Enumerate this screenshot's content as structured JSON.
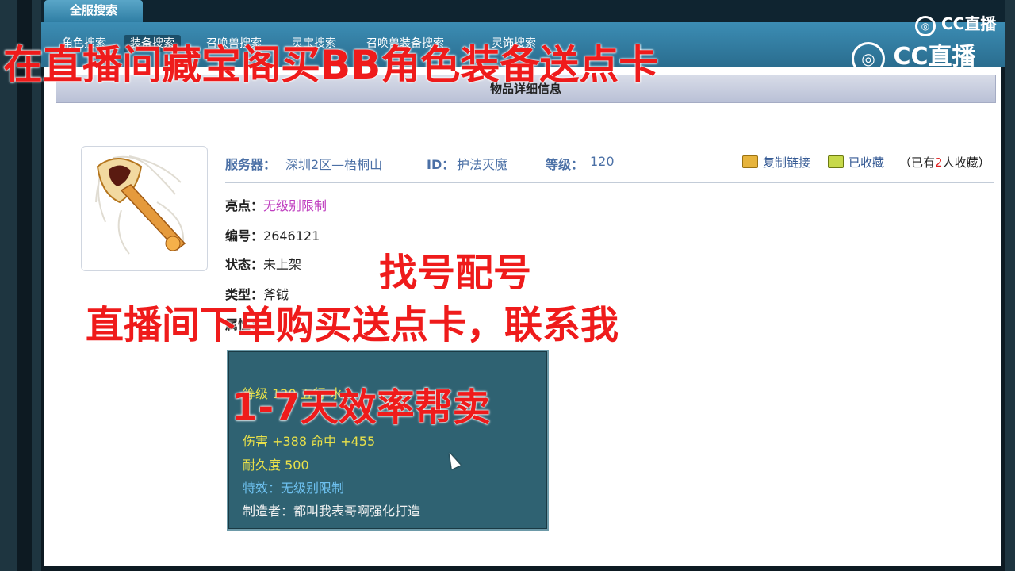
{
  "header": {
    "main_tab": "全服搜索",
    "sub_tabs": [
      "角色搜索",
      "装备搜索",
      "召唤兽搜索",
      "灵宝搜索",
      "召唤兽装备搜索",
      "灵饰搜索"
    ]
  },
  "panel": {
    "title": "物品详细信息"
  },
  "item": {
    "server_label": "服务器：",
    "server_value": "深圳2区—梧桐山",
    "id_label": "ID：",
    "id_value": "护法灭魔",
    "level_label": "等级：",
    "level_value": "120",
    "actions": {
      "copy_link": "复制链接",
      "favorited": "已收藏",
      "fav_count_prefix": "（已有",
      "fav_count": "2",
      "fav_count_suffix": "人收藏）"
    },
    "fields": [
      {
        "label": "亮点：",
        "value": "无级别限制"
      },
      {
        "label": "编号：",
        "value": "2646121"
      },
      {
        "label": "状态：",
        "value": "未上架"
      },
      {
        "label": "类型：",
        "value": "斧钺"
      },
      {
        "label": "属性：",
        "value": ""
      }
    ],
    "stats": {
      "level_line": "等级 120 五行 水",
      "damage_line": "伤害 +388 命中 +455",
      "durability_line": "耐久度 500",
      "special_line": "特效：无级别限制",
      "maker_line": "制造者：都叫我表哥啊强化打造"
    }
  },
  "overlays": {
    "top_banner": "在直播间藏宝阁买BB角色装备送点卡",
    "mid_line1": "找号配号",
    "mid_line2": "直播间下单购买送点卡，联系我",
    "stats_line": "1-7天效率帮卖"
  },
  "watermark": {
    "logo_small": "CC直播",
    "logo_large": "CC直播"
  },
  "colors": {
    "overlay_red": "#ef1b1b",
    "nav_blue": "#3c8db4",
    "stats_bg": "#2f6272"
  }
}
